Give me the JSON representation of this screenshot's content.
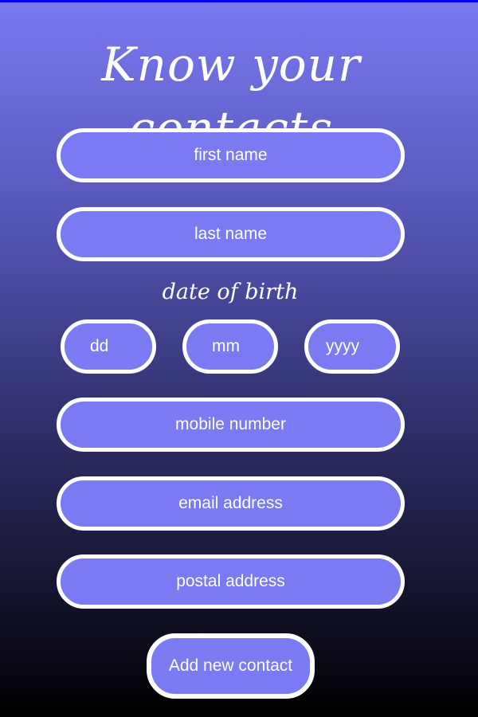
{
  "header": {
    "title": "Know your contacts"
  },
  "form": {
    "first_name": {
      "placeholder": "first name"
    },
    "last_name": {
      "placeholder": "last name"
    },
    "dob_label": "date of birth",
    "dob_day": {
      "placeholder": "dd"
    },
    "dob_month": {
      "placeholder": "mm"
    },
    "dob_year": {
      "placeholder": "yyyy"
    },
    "mobile": {
      "placeholder": "mobile number"
    },
    "email": {
      "placeholder": "email address"
    },
    "postal": {
      "placeholder": "postal address"
    },
    "submit_label": "Add new contact"
  },
  "colors": {
    "field_background": "#7a7af2",
    "field_border": "#ffffff",
    "gradient_top": "#7a7af2",
    "gradient_bottom": "#000000",
    "top_border": "#0000ff"
  }
}
